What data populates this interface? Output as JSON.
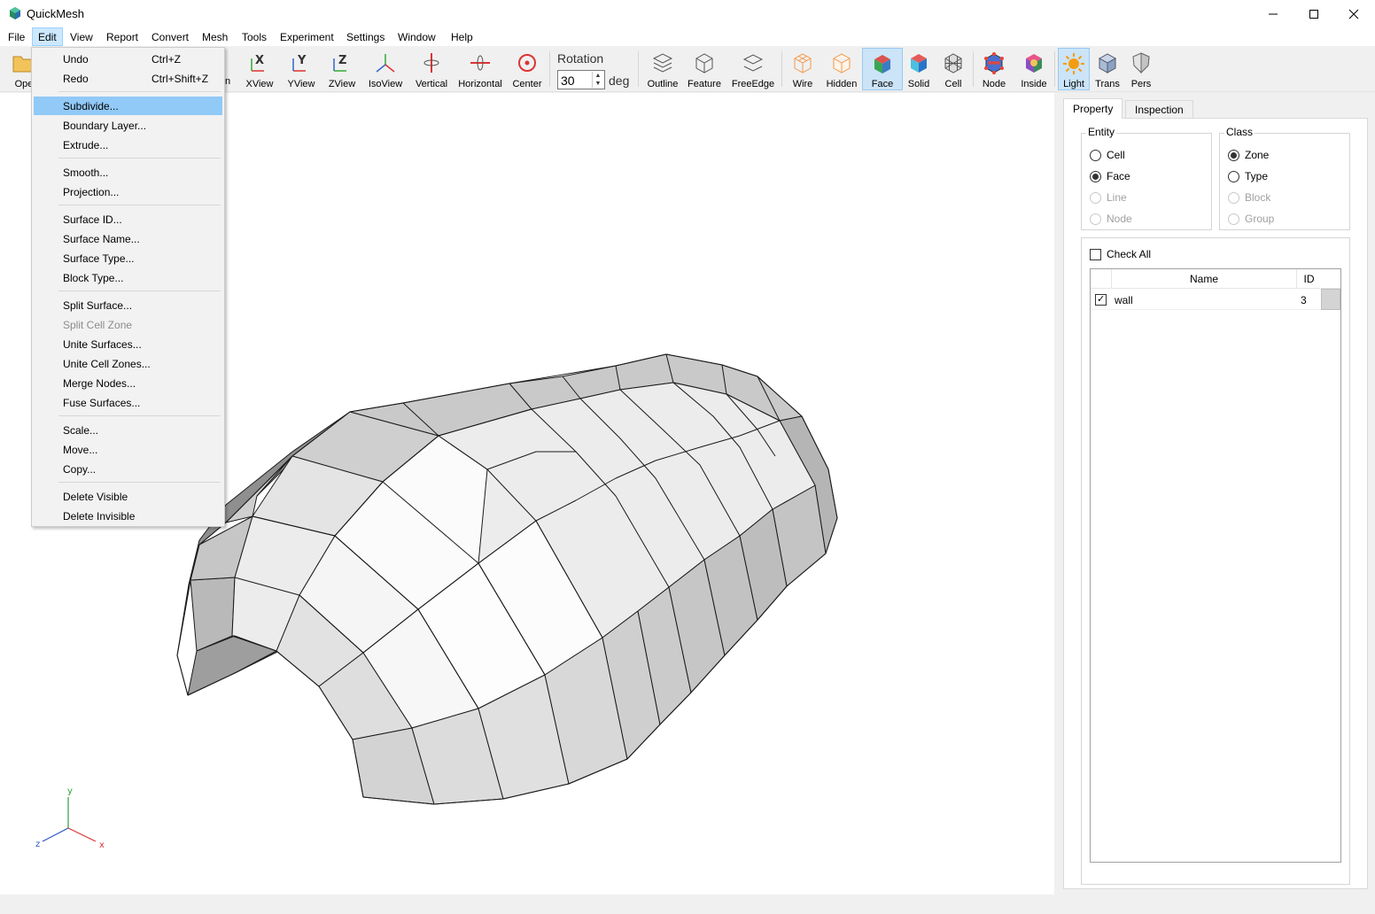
{
  "window": {
    "title": "QuickMesh"
  },
  "menubar": [
    "File",
    "Edit",
    "View",
    "Report",
    "Convert",
    "Mesh",
    "Tools",
    "Experiment",
    "Settings",
    "Window",
    "Help"
  ],
  "toolbar": {
    "open_partial": "Ope",
    "open_partial2": "n",
    "views": [
      "XView",
      "YView",
      "ZView",
      "IsoView",
      "Vertical",
      "Horizontal",
      "Center"
    ],
    "rotation": {
      "label": "Rotation",
      "value": "30",
      "unit": "deg"
    },
    "display": [
      "Outline",
      "Feature",
      "FreeEdge",
      "Wire",
      "Hidden",
      "Face",
      "Solid",
      "Cell",
      "Node",
      "Inside",
      "Light",
      "Trans",
      "Pers"
    ]
  },
  "edit_menu": {
    "items": [
      {
        "label": "Undo",
        "shortcut": "Ctrl+Z"
      },
      {
        "label": "Redo",
        "shortcut": "Ctrl+Shift+Z"
      },
      {
        "label": "Subdivide..."
      },
      {
        "label": "Boundary Layer..."
      },
      {
        "label": "Extrude..."
      },
      {
        "label": "Smooth..."
      },
      {
        "label": "Projection..."
      },
      {
        "label": "Surface ID..."
      },
      {
        "label": "Surface Name..."
      },
      {
        "label": "Surface Type..."
      },
      {
        "label": "Block Type..."
      },
      {
        "label": "Split Surface..."
      },
      {
        "label": "Split Cell Zone"
      },
      {
        "label": "Unite Surfaces..."
      },
      {
        "label": "Unite Cell Zones..."
      },
      {
        "label": "Merge Nodes..."
      },
      {
        "label": "Fuse Surfaces..."
      },
      {
        "label": "Scale..."
      },
      {
        "label": "Move..."
      },
      {
        "label": "Copy..."
      },
      {
        "label": "Delete Visible"
      },
      {
        "label": "Delete Invisible"
      }
    ]
  },
  "panel": {
    "tabs": [
      "Property",
      "Inspection"
    ],
    "entity": {
      "title": "Entity",
      "options": [
        "Cell",
        "Face",
        "Line",
        "Node"
      ],
      "selected": "Face"
    },
    "class": {
      "title": "Class",
      "options": [
        "Zone",
        "Type",
        "Block",
        "Group"
      ],
      "selected": "Zone"
    },
    "check_all": "Check All",
    "table": {
      "columns": [
        "Name",
        "ID"
      ],
      "rows": [
        {
          "name": "wall",
          "id": "3",
          "checked": true
        }
      ]
    }
  },
  "axes": {
    "y": "y",
    "z": "z",
    "x": "x"
  }
}
